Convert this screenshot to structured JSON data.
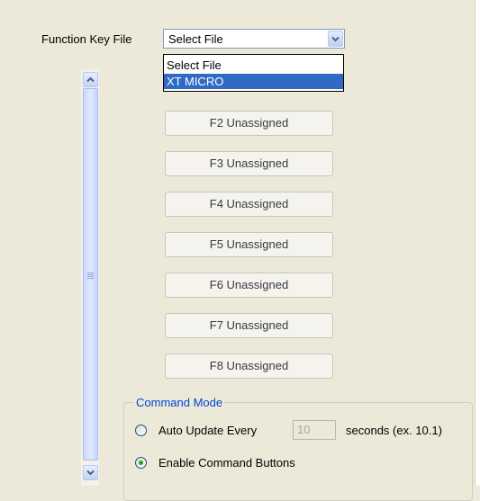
{
  "function_key_file": {
    "label": "Function Key File",
    "selected": "Select File",
    "options": [
      "Select File",
      "XT MICRO"
    ],
    "highlighted": "XT MICRO"
  },
  "function_keys": [
    {
      "label": "F2 Unassigned"
    },
    {
      "label": "F3 Unassigned"
    },
    {
      "label": "F4 Unassigned"
    },
    {
      "label": "F5 Unassigned"
    },
    {
      "label": "F6 Unassigned"
    },
    {
      "label": "F7 Unassigned"
    },
    {
      "label": "F8 Unassigned"
    }
  ],
  "command_mode": {
    "title": "Command Mode",
    "auto_update_label": "Auto Update Every",
    "interval_value": "10",
    "interval_suffix": "seconds (ex. 10.1)",
    "enable_buttons_label": "Enable Command Buttons",
    "selected_option": "Enable Command Buttons"
  },
  "colors": {
    "selection": "#316ac5",
    "group_title": "#0046d5",
    "radio_dot": "#21a121"
  }
}
